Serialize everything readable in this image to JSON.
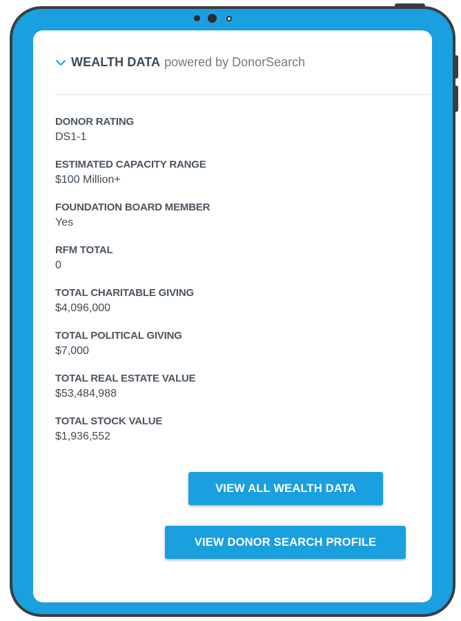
{
  "colors": {
    "frame_blue": "#1a9fdf",
    "frame_border": "#3a3d40",
    "button_blue": "#1a9fdf",
    "label_text": "#4a5560",
    "value_text": "#3f4a54"
  },
  "section": {
    "icon": "chevron-down-icon",
    "title": "WEALTH DATA",
    "subtitle": "powered by DonorSearch"
  },
  "fields": [
    {
      "label": "DONOR RATING",
      "value": "DS1-1"
    },
    {
      "label": "ESTIMATED CAPACITY RANGE",
      "value": "$100 Million+"
    },
    {
      "label": "FOUNDATION BOARD MEMBER",
      "value": "Yes"
    },
    {
      "label": "RFM TOTAL",
      "value": "0"
    },
    {
      "label": "TOTAL CHARITABLE GIVING",
      "value": "$4,096,000"
    },
    {
      "label": "TOTAL POLITICAL GIVING",
      "value": "$7,000"
    },
    {
      "label": "TOTAL REAL ESTATE VALUE",
      "value": "$53,484,988"
    },
    {
      "label": "TOTAL STOCK VALUE",
      "value": "$1,936,552"
    }
  ],
  "buttons": {
    "view_all": "VIEW ALL WEALTH DATA",
    "view_profile": "VIEW DONOR SEARCH PROFILE"
  }
}
